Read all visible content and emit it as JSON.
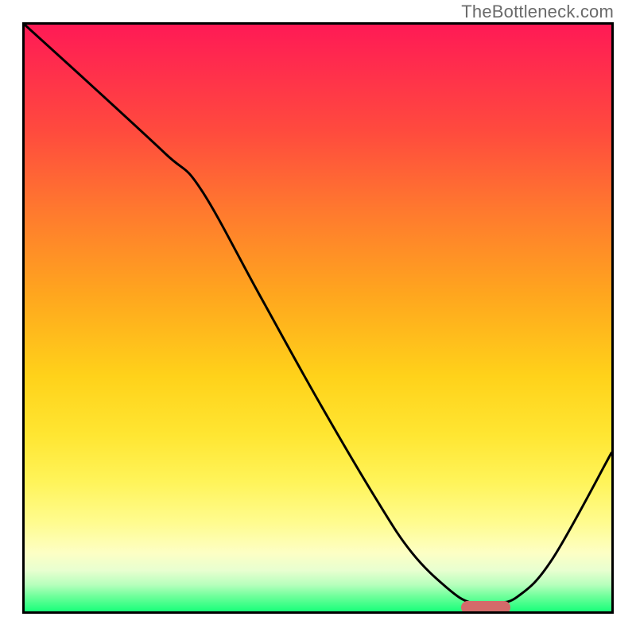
{
  "watermark": "TheBottleneck.com",
  "chart_data": {
    "type": "line",
    "title": "",
    "xlabel": "",
    "ylabel": "",
    "xlim": [
      0,
      100
    ],
    "ylim": [
      0,
      100
    ],
    "grid": false,
    "legend": false,
    "series": [
      {
        "name": "bottleneck-curve",
        "x": [
          0,
          11,
          24,
          30,
          40,
          50,
          60,
          66,
          72,
          76,
          80,
          84,
          90,
          100
        ],
        "values": [
          100,
          90,
          78,
          72,
          54,
          36,
          19,
          10,
          4,
          1.5,
          1.5,
          2.5,
          9,
          27
        ]
      }
    ],
    "annotations": [
      {
        "name": "optimal-marker",
        "x": 78,
        "y": 1.5,
        "color": "#d46a6a"
      }
    ],
    "background_gradient": {
      "top": "#ff1a55",
      "mid": "#ffd21a",
      "bottom": "#1aff7a"
    }
  }
}
